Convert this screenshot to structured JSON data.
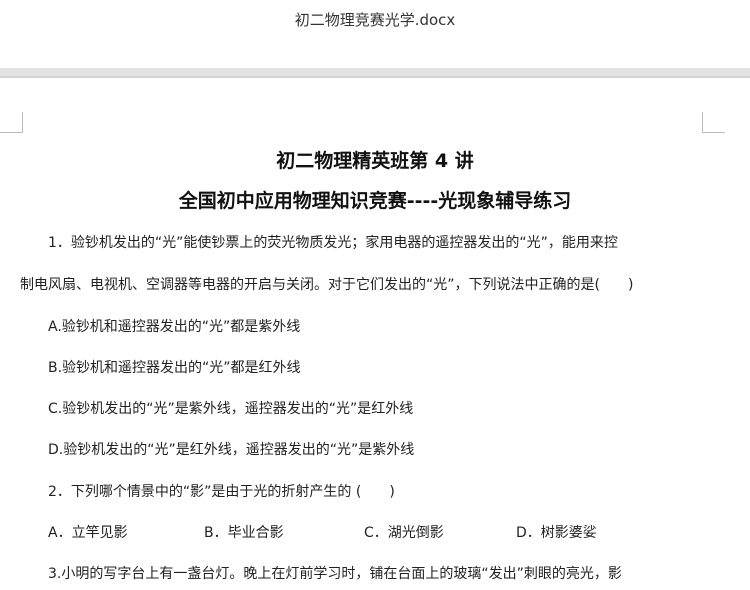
{
  "window": {
    "file_name": "初二物理竞赛光学.docx"
  },
  "document": {
    "heading1": "初二物理精英班第 4 讲",
    "heading2": "全国初中应用物理知识竞赛----光现象辅导练习",
    "q1": {
      "line1": "1．验钞机发出的“光”能使钞票上的荧光物质发光；家用电器的遥控器发出的“光”，能用来控",
      "line2": "制电风扇、电视机、空调器等电器的开启与关闭。对于它们发出的“光”，下列说法中正确的是(　　)",
      "options": [
        "A.验钞机和遥控器发出的“光”都是紫外线",
        "B.验钞机和遥控器发出的“光”都是红外线",
        "C.验钞机发出的“光”是紫外线，遥控器发出的“光”是红外线",
        "D.验钞机发出的“光”是红外线，遥控器发出的“光”是紫外线"
      ]
    },
    "q2": {
      "text": "2．下列哪个情景中的“影”是由于光的折射产生的 (　　)",
      "options": [
        "A．立竿见影",
        "B．毕业合影",
        "C．湖光倒影",
        "D．树影婆娑"
      ]
    },
    "q3": {
      "line1": "3.小明的写字台上有一盏台灯。晚上在灯前学习时，铺在台面上的玻璃“发出”刺眼的亮光，影"
    }
  }
}
